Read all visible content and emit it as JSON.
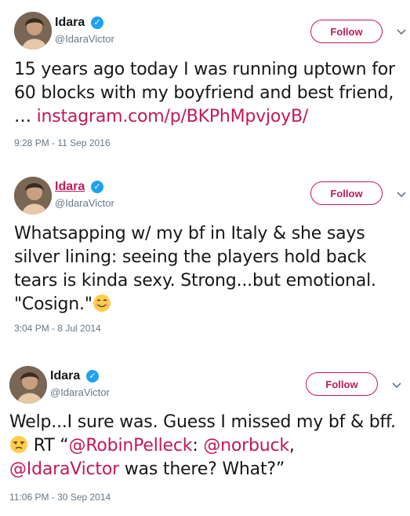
{
  "tweets": [
    {
      "name": "Idara",
      "handle": "@IdaraVictor",
      "follow_label": "Follow",
      "lines": [
        "15 years ago today I was running uptown for",
        "60 blocks with my boyfriend and best friend,"
      ],
      "line3_prefix": "… ",
      "link": "instagram.com/p/BKPhMpvjoyB/",
      "timestamp": "9:28 PM - 11 Sep 2016"
    },
    {
      "name": "Idara",
      "handle": "@IdaraVictor",
      "follow_label": "Follow",
      "lines": [
        "Whatsapping w/ my bf in Italy & she says",
        "silver lining: seeing the players hold back",
        "tears is kinda sexy. Strong...but emotional."
      ],
      "line4": "\"Cosign.\"",
      "emoji": "smiling-face-emoji",
      "timestamp": "3:04 PM - 8 Jul 2014"
    },
    {
      "name": "Idara",
      "handle": "@IdaraVictor",
      "follow_label": "Follow",
      "line1": "Welp...I sure was. Guess I missed my bf & bff.",
      "emoji": "unamused-face-emoji",
      "rt_prefix": " RT “",
      "mention1": "@RobinPelleck",
      "colon": ": ",
      "mention2": "@norbuck",
      "comma": ",",
      "mention3": "@IdaraVictor",
      "line3_suffix": " was there? What?”",
      "timestamp": "11:06 PM - 30 Sep 2014"
    }
  ],
  "colors": {
    "accent": "#c2185b",
    "verified": "#1da1f2",
    "meta": "#657786"
  }
}
